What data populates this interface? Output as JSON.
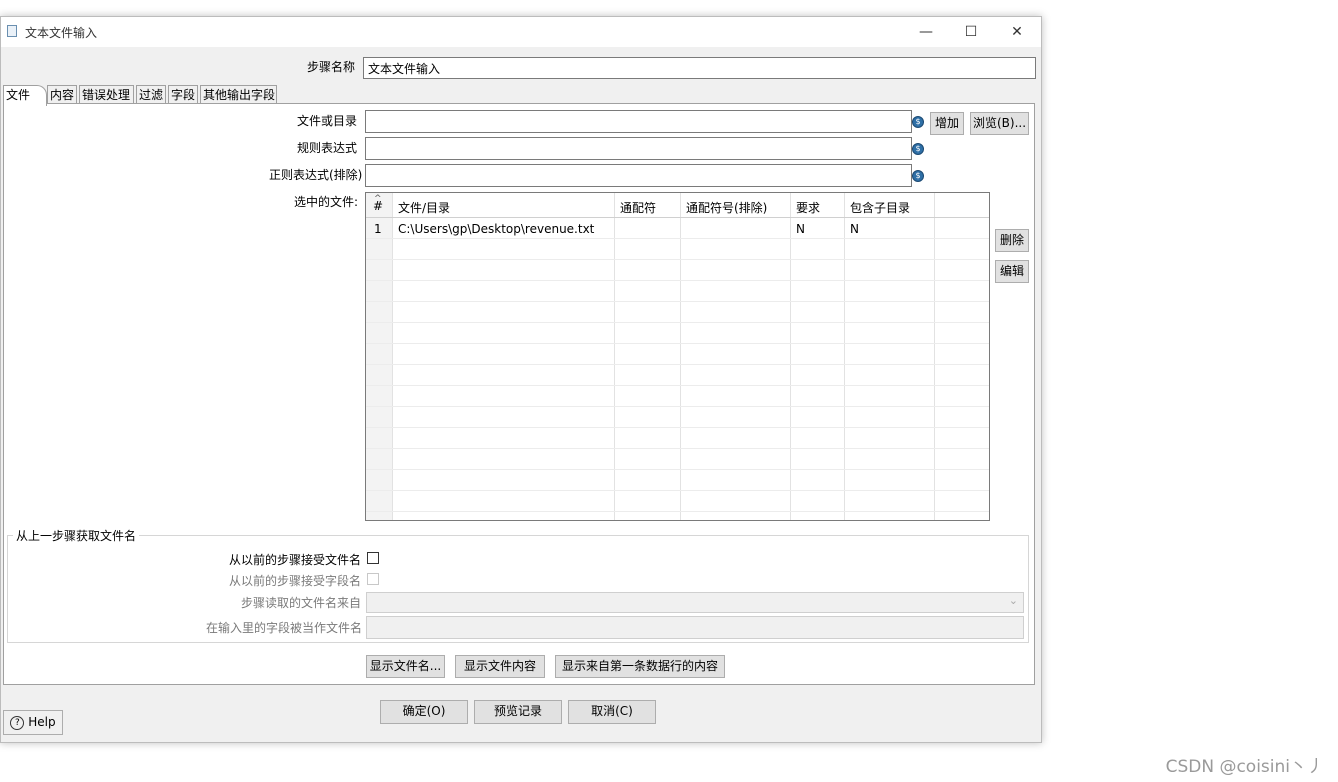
{
  "window": {
    "title": "文本文件输入",
    "controls": {
      "minimize": "—",
      "maximize": "☐",
      "close": "✕"
    }
  },
  "step_name": {
    "label": "步骤名称",
    "value": "文本文件输入"
  },
  "tabs": [
    {
      "label": "文件",
      "active": true
    },
    {
      "label": "内容"
    },
    {
      "label": "错误处理"
    },
    {
      "label": "过滤"
    },
    {
      "label": "字段"
    },
    {
      "label": "其他输出字段"
    }
  ],
  "file_tab": {
    "file_or_dir_label": "文件或目录",
    "regex_label": "规则表达式",
    "regex_exclude_label": "正则表达式(排除)",
    "selected_files_label": "选中的文件:",
    "add_button": "增加",
    "browse_button": "浏览(B)...",
    "delete_button": "删除",
    "edit_button": "编辑",
    "var_icon": "$",
    "table": {
      "columns": [
        "#",
        "文件/目录",
        "通配符",
        "通配符号(排除)",
        "要求",
        "包含子目录"
      ],
      "rows": [
        [
          "1",
          "C:\\Users\\gp\\Desktop\\revenue.txt",
          "",
          "",
          "N",
          "N"
        ]
      ]
    }
  },
  "prev_step_group": {
    "title": "从上一步骤获取文件名",
    "accept_filenames_label": "从以前的步骤接受文件名",
    "accept_fieldnames_label": "从以前的步骤接受字段名",
    "read_from_step_label": "步骤读取的文件名来自",
    "field_as_filename_label": "在输入里的字段被当作文件名"
  },
  "show_buttons": {
    "show_filenames": "显示文件名...",
    "show_file_content": "显示文件内容",
    "show_first_row": "显示来自第一条数据行的内容"
  },
  "footer": {
    "help": "Help",
    "ok": "确定(O)",
    "preview": "预览记录",
    "cancel": "取消(C)"
  },
  "watermark": "CSDN @coisini丶丿"
}
